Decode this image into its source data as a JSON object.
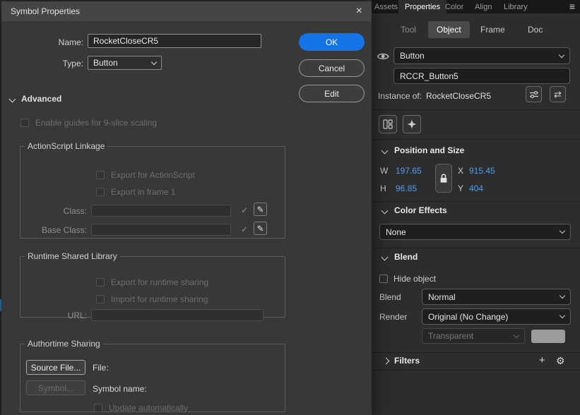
{
  "icons": {
    "close": "×",
    "menu": "≡",
    "check": "✓",
    "pencil": "✎",
    "plus": "+",
    "gear": "⚙",
    "swap_arrows": "⇄"
  },
  "colors": {
    "accent_blue": "#1473e6",
    "value_blue": "#4e9ef2",
    "edge_accent": "#2e7fe0",
    "swatch_gray": "#9c9c9c"
  },
  "dialog": {
    "title": "Symbol Properties",
    "fields": {
      "name_label": "Name:",
      "name_value": "RocketCloseCR5",
      "type_label": "Type:",
      "type_value": "Button"
    },
    "buttons": {
      "ok": "OK",
      "cancel": "Cancel",
      "edit": "Edit"
    },
    "advanced_label": "Advanced",
    "nine_slice_label": "Enable guides for 9-slice scaling",
    "actionscript_linkage": {
      "legend": "ActionScript Linkage",
      "export_actionscript": "Export for ActionScript",
      "export_frame1": "Export in frame 1",
      "class_label": "Class:",
      "class_value": "",
      "base_class_label": "Base Class:",
      "base_class_value": ""
    },
    "runtime_shared_library": {
      "legend": "Runtime Shared Library",
      "export_sharing": "Export for runtime sharing",
      "import_sharing": "Import for runtime sharing",
      "url_label": "URL:",
      "url_value": ""
    },
    "authortime_sharing": {
      "legend": "Authortime Sharing",
      "source_file_button": "Source File...",
      "file_label": "File:",
      "symbol_button": "Symbol...",
      "symbol_name_label": "Symbol name:",
      "update_automatically": "Update automatically"
    }
  },
  "panel": {
    "tabs": {
      "assets": "Assets",
      "properties": "Properties",
      "color": "Color",
      "align": "Align",
      "library": "Library"
    },
    "subtabs": {
      "tool": "Tool",
      "object": "Object",
      "frame": "Frame",
      "doc": "Doc"
    },
    "instance": {
      "type_value": "Button",
      "name_value": "RCCR_Button5",
      "instance_of_label": "Instance of:",
      "instance_of_value": "RocketCloseCR5"
    },
    "position_size": {
      "title": "Position and Size",
      "w_label": "W",
      "w_value": "197.65",
      "h_label": "H",
      "h_value": "96.85",
      "x_label": "X",
      "x_value": "915.45",
      "y_label": "Y",
      "y_value": "404"
    },
    "color_effects": {
      "title": "Color Effects",
      "style_value": "None"
    },
    "blend": {
      "title": "Blend",
      "hide_object_label": "Hide object",
      "blend_label": "Blend",
      "blend_value": "Normal",
      "render_label": "Render",
      "render_value": "Original (No Change)",
      "transparent_value": "Transparent"
    },
    "filters": {
      "title": "Filters"
    }
  }
}
